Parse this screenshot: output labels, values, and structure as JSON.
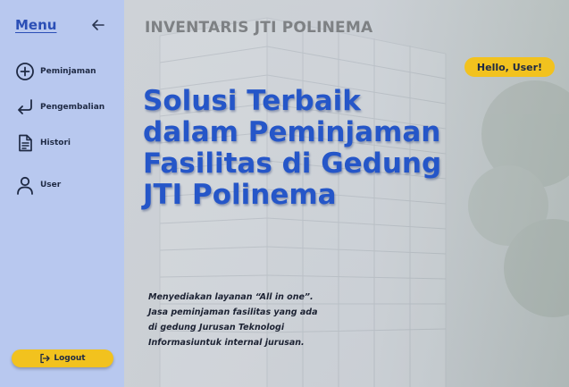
{
  "sidebar": {
    "title": "Menu",
    "items": [
      {
        "label": "Peminjaman",
        "icon": "plus-circle-icon"
      },
      {
        "label": "Pengembalian",
        "icon": "return-arrow-icon"
      },
      {
        "label": "Histori",
        "icon": "document-icon"
      },
      {
        "label": "User",
        "icon": "user-icon"
      }
    ],
    "logout_label": "Logout"
  },
  "header": {
    "brand": "INVENTARIS JTI POLINEMA",
    "greeting": "Hello, User!"
  },
  "hero": {
    "headline": [
      "Solusi Terbaik",
      "dalam Peminjaman",
      "Fasilitas di Gedung",
      "JTI Polinema"
    ],
    "description": [
      "Menyediakan layanan “All in one”.",
      "Jasa peminjaman fasilitas yang ada",
      "di gedung Jurusan Teknologi",
      "Informasiuntuk internal jurusan."
    ]
  },
  "colors": {
    "sidebar_bg": "#b8c8ef",
    "accent_yellow": "#f2c21e",
    "headline_blue": "#2556c8",
    "menu_blue": "#2b4fb6"
  }
}
